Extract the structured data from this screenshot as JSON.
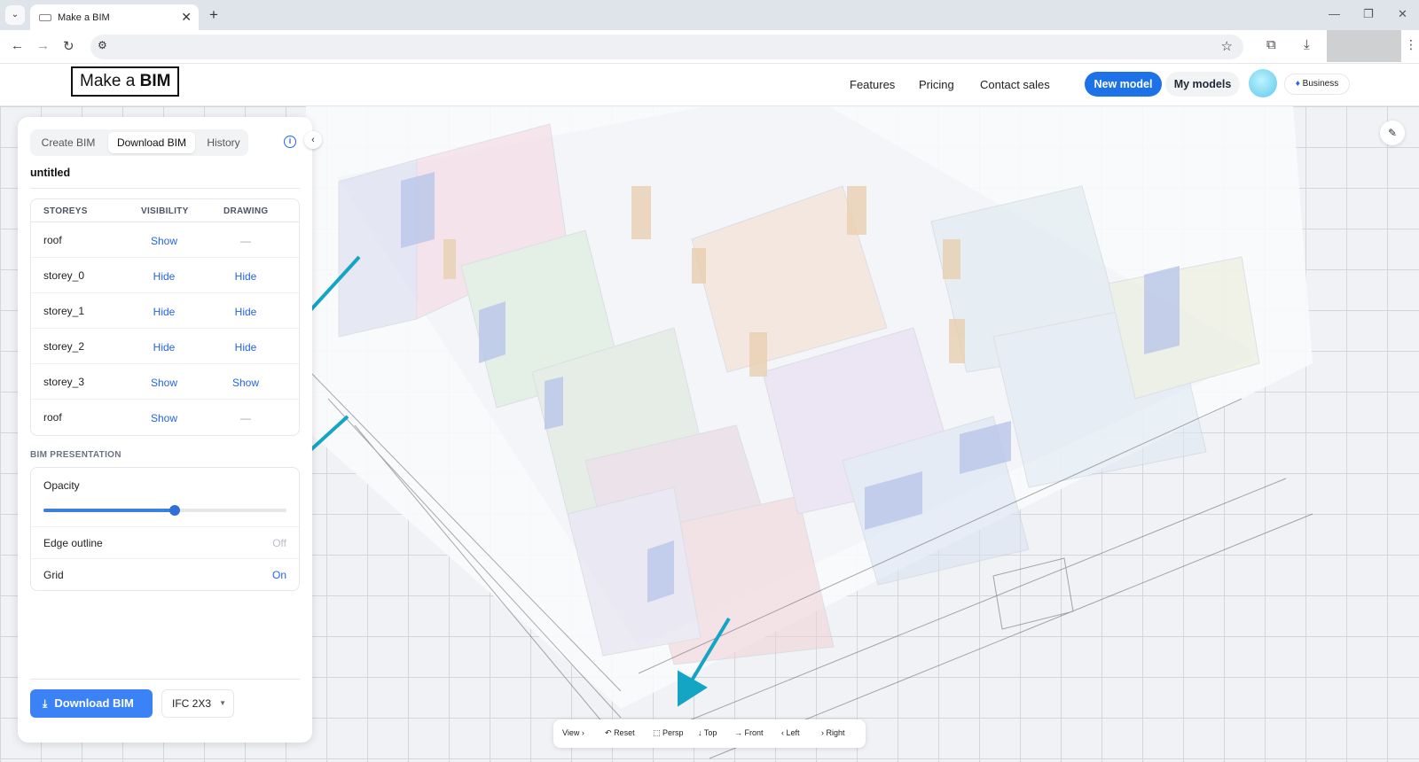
{
  "browser": {
    "tab_title": "Make a BIM",
    "new_tab": "+",
    "tab_close": "✕",
    "tab_search": "⌄"
  },
  "header": {
    "logo_prefix": "Make a ",
    "logo_bold": "BIM",
    "nav": [
      "Features",
      "Pricing",
      "Contact sales"
    ],
    "new_model": "New model",
    "my_models": "My models",
    "plan": "Business"
  },
  "panel": {
    "tabs": [
      "Create BIM",
      "Download BIM",
      "History"
    ],
    "active_tab": "Download BIM",
    "model_name": "untitled",
    "table_headers": [
      "STOREYS",
      "VISIBILITY",
      "DRAWING"
    ],
    "storeys": [
      {
        "name": "roof",
        "visibility": "Show",
        "drawing": "—"
      },
      {
        "name": "storey_0",
        "visibility": "Hide",
        "drawing": "Hide"
      },
      {
        "name": "storey_1",
        "visibility": "Hide",
        "drawing": "Hide"
      },
      {
        "name": "storey_2",
        "visibility": "Hide",
        "drawing": "Hide"
      },
      {
        "name": "storey_3",
        "visibility": "Show",
        "drawing": "Show"
      },
      {
        "name": "roof",
        "visibility": "Show",
        "drawing": "—"
      }
    ],
    "presentation_title": "BIM PRESENTATION",
    "opacity_label": "Opacity",
    "opacity_value": 0.54,
    "edge_outline_label": "Edge outline",
    "edge_outline_value": "Off",
    "grid_label": "Grid",
    "grid_value": "On",
    "download_label": "Download BIM",
    "format": "IFC 2X3"
  },
  "toolbar": {
    "items": [
      "View",
      "Reset",
      "Persp",
      "Top",
      "Front",
      "Left",
      "Right"
    ]
  },
  "colors": {
    "accent": "#1d72e8",
    "annotation_arrow": "#14a4c4"
  }
}
